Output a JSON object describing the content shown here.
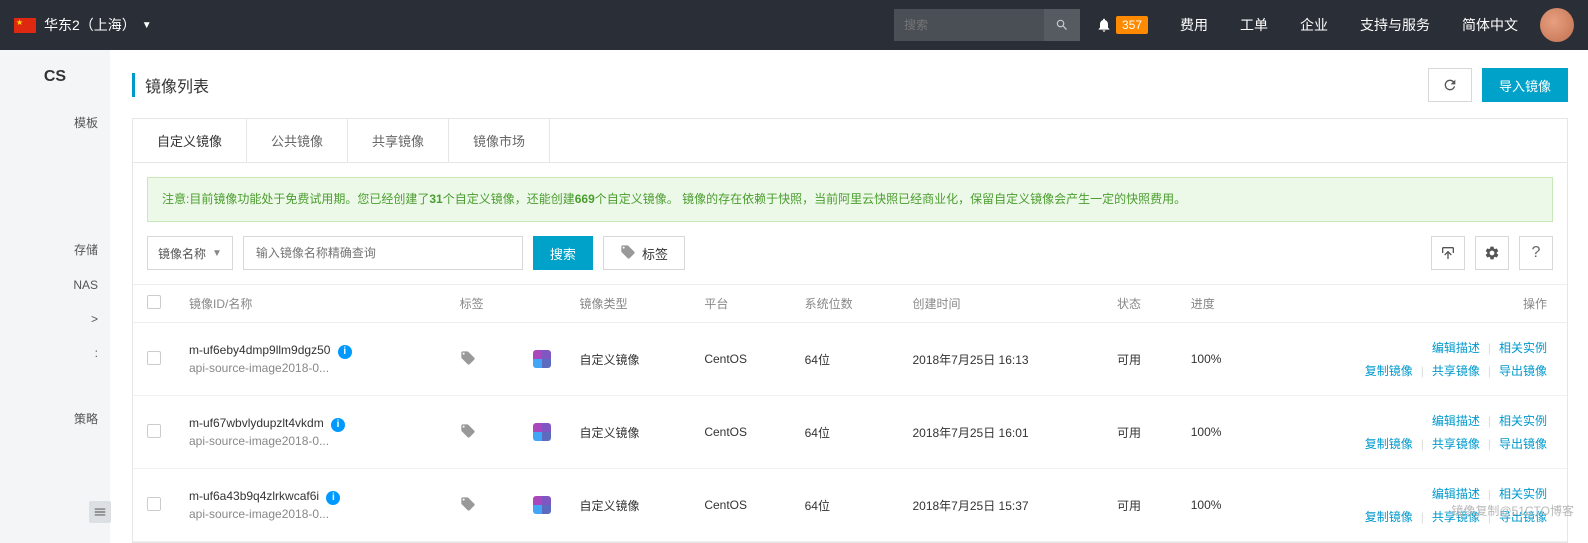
{
  "topbar": {
    "region": "华东2（上海）",
    "search_placeholder": "搜索",
    "notification_count": "357",
    "nav": [
      "费用",
      "工单",
      "企业",
      "支持与服务",
      "简体中文"
    ]
  },
  "sidebar": {
    "logo_suffix": "CS",
    "items": [
      "模板",
      "存储",
      "NAS",
      ">",
      ":",
      "策略"
    ]
  },
  "page": {
    "title": "镜像列表",
    "refresh_label": "刷新",
    "import_label": "导入镜像"
  },
  "tabs": [
    "自定义镜像",
    "公共镜像",
    "共享镜像",
    "镜像市场"
  ],
  "notice": {
    "prefix": "注意:目前镜像功能处于免费试用期。您已经创建了",
    "count1": "31",
    "mid1": "个自定义镜像，还能创建",
    "count2": "669",
    "mid2": "个自定义镜像。 镜像的存在依赖于快照，当前阿里云快照已经商业化，保留自定义镜像会产生一定的快照费用。"
  },
  "toolbar": {
    "filter_label": "镜像名称",
    "search_placeholder": "输入镜像名称精确查询",
    "search_btn": "搜索",
    "tag_btn": "标签"
  },
  "columns": {
    "id": "镜像ID/名称",
    "tag": "标签",
    "type": "镜像类型",
    "platform": "平台",
    "bits": "系统位数",
    "created": "创建时间",
    "status": "状态",
    "progress": "进度",
    "ops": "操作"
  },
  "op_labels": {
    "edit_desc": "编辑描述",
    "related": "相关实例",
    "copy": "复制镜像",
    "share": "共享镜像",
    "export": "导出镜像"
  },
  "rows": [
    {
      "id": "m-uf6eby4dmp9llm9dgz50",
      "name": "api-source-image2018-0...",
      "type": "自定义镜像",
      "platform": "CentOS",
      "bits": "64位",
      "created": "2018年7月25日 16:13",
      "status": "可用",
      "progress": "100%"
    },
    {
      "id": "m-uf67wbvlydupzlt4vkdm",
      "name": "api-source-image2018-0...",
      "type": "自定义镜像",
      "platform": "CentOS",
      "bits": "64位",
      "created": "2018年7月25日 16:01",
      "status": "可用",
      "progress": "100%"
    },
    {
      "id": "m-uf6a43b9q4zlrkwcaf6i",
      "name": "api-source-image2018-0...",
      "type": "自定义镜像",
      "platform": "CentOS",
      "bits": "64位",
      "created": "2018年7月25日 15:37",
      "status": "可用",
      "progress": "100%"
    }
  ],
  "watermark": "镜像复制@51CTO博客"
}
